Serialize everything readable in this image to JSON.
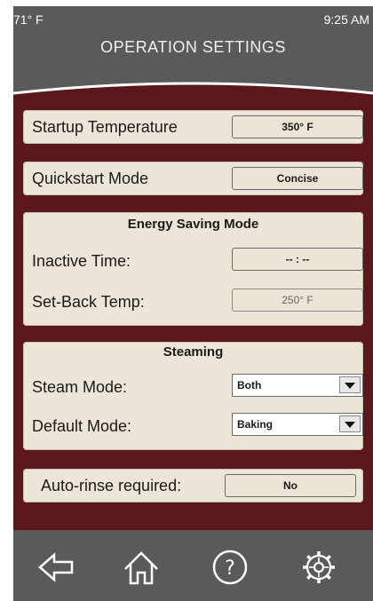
{
  "status": {
    "temperature": "71° F",
    "time": "9:25 AM"
  },
  "header": {
    "title": "OPERATION SETTINGS"
  },
  "startup": {
    "label": "Startup Temperature",
    "value": "350° F"
  },
  "quickstart": {
    "label": "Quickstart Mode",
    "value": "Concise"
  },
  "energy": {
    "title": "Energy Saving Mode",
    "inactive_label": "Inactive Time:",
    "inactive_value": "-- : --",
    "setback_label": "Set-Back Temp:",
    "setback_value": "250° F"
  },
  "steaming": {
    "title": "Steaming",
    "steam_label": "Steam Mode:",
    "steam_value": "Both",
    "default_label": "Default Mode:",
    "default_value": "Baking"
  },
  "autorinse": {
    "label": "Auto-rinse required:",
    "value": "No"
  },
  "footer": {
    "icons": [
      "back-arrow-icon",
      "home-icon",
      "help-icon",
      "settings-gear-icon"
    ]
  },
  "colors": {
    "header": "#5a5a5a",
    "background": "#5b1719",
    "card": "#ede6d8"
  }
}
